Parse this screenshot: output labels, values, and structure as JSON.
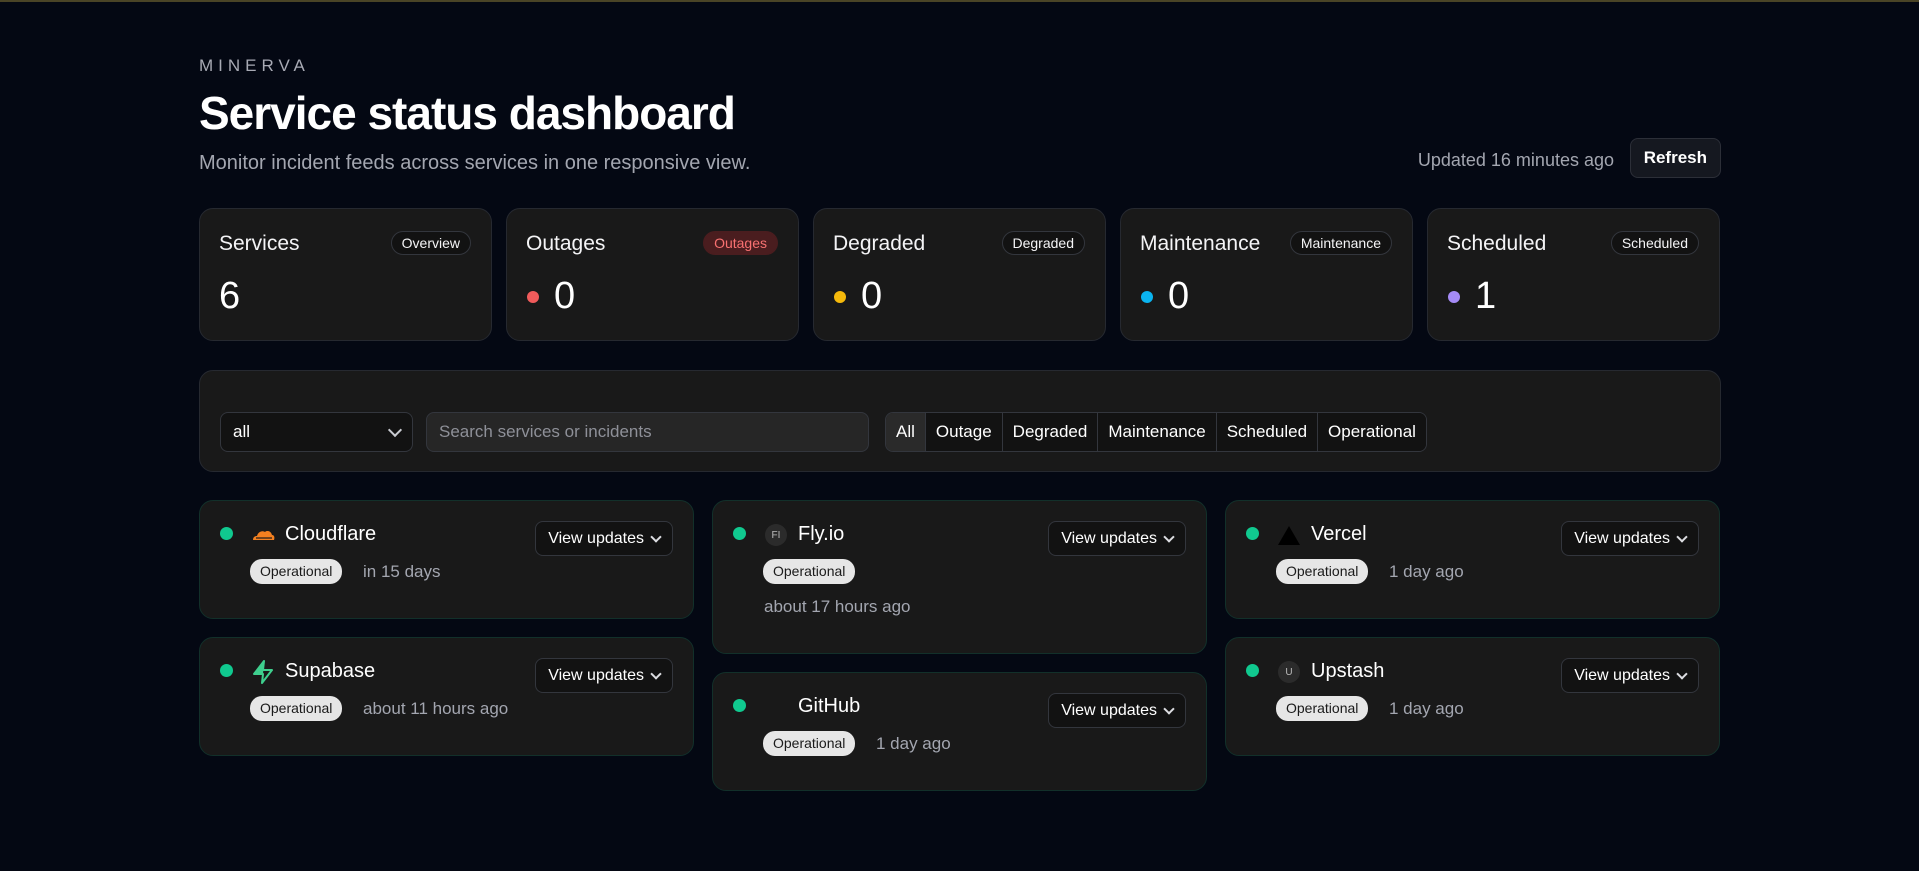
{
  "brand": "MINERVA",
  "title": "Service status dashboard",
  "subtitle": "Monitor incident feeds across services in one responsive view.",
  "updated": "Updated 16 minutes ago",
  "refresh_label": "Refresh",
  "stats": [
    {
      "label": "Services",
      "badge": "Overview",
      "value": "6"
    },
    {
      "label": "Outages",
      "badge": "Outages",
      "value": "0",
      "dot_color": "#f05b5b"
    },
    {
      "label": "Degraded",
      "badge": "Degraded",
      "value": "0",
      "dot_color": "#f5b90b"
    },
    {
      "label": "Maintenance",
      "badge": "Maintenance",
      "value": "0",
      "dot_color": "#0ab4f0"
    },
    {
      "label": "Scheduled",
      "badge": "Scheduled",
      "value": "1",
      "dot_color": "#a58bf6"
    }
  ],
  "filters": {
    "select_value": "all",
    "search_placeholder": "Search services or incidents",
    "tabs": [
      "All",
      "Outage",
      "Degraded",
      "Maintenance",
      "Scheduled",
      "Operational"
    ],
    "active_tab": "All"
  },
  "view_updates_label": "View updates",
  "services": [
    {
      "name": "Cloudflare",
      "status": "Operational",
      "time": "in 15 days",
      "logo": "cloudflare-icon"
    },
    {
      "name": "Supabase",
      "status": "Operational",
      "time": "about 11 hours ago",
      "logo": "supabase-icon"
    },
    {
      "name": "Fly.io",
      "status": "Operational",
      "time": "about 17 hours ago",
      "logo_text": "FI",
      "logo": "flyio-icon"
    },
    {
      "name": "GitHub",
      "status": "Operational",
      "time": "1 day ago",
      "logo": "github-icon"
    },
    {
      "name": "Vercel",
      "status": "Operational",
      "time": "1 day ago",
      "logo": "vercel-icon"
    },
    {
      "name": "Upstash",
      "status": "Operational",
      "time": "1 day ago",
      "logo_text": "U",
      "logo": "upstash-icon"
    }
  ],
  "colors": {
    "background": "#040813",
    "card": "#191919",
    "operational": "#10c98f",
    "outage_badge_text": "#f87171"
  }
}
